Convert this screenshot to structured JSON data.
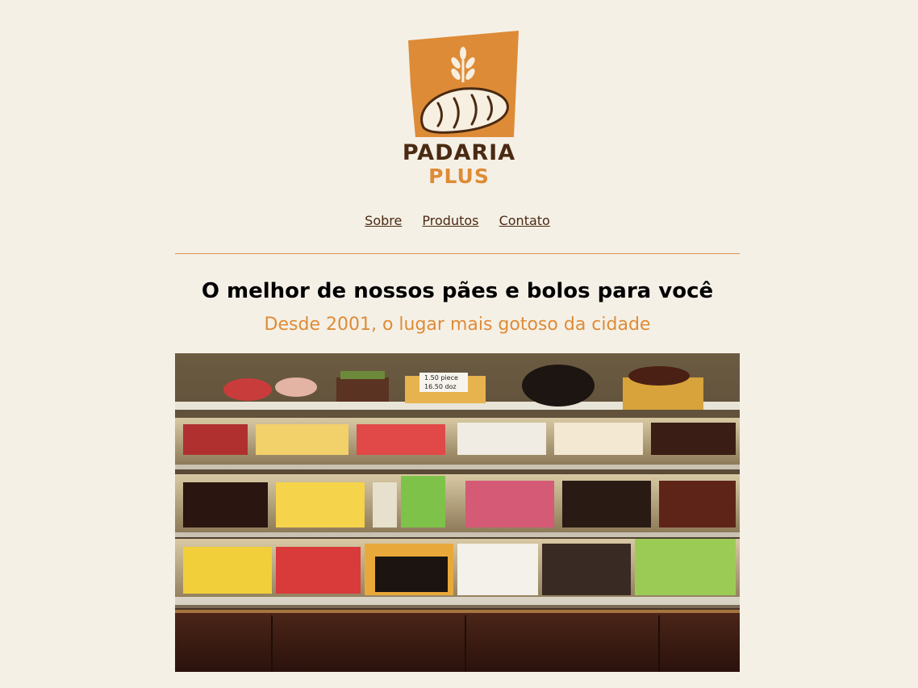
{
  "brand": {
    "name_line1": "PADARIA",
    "name_line2": "PLUS",
    "colors": {
      "accent": "#de8b37",
      "dark": "#4a2a12",
      "background": "#f5f0e6"
    }
  },
  "nav": {
    "items": [
      {
        "label": "Sobre"
      },
      {
        "label": "Produtos"
      },
      {
        "label": "Contato"
      }
    ]
  },
  "hero": {
    "title": "O melhor de nossos pães e bolos para você",
    "subtitle": "Desde 2001, o lugar mais gotoso da cidade"
  },
  "showcase": {
    "price_tag": {
      "line1": "1.50  piece",
      "line2": "16.50  doz"
    }
  }
}
